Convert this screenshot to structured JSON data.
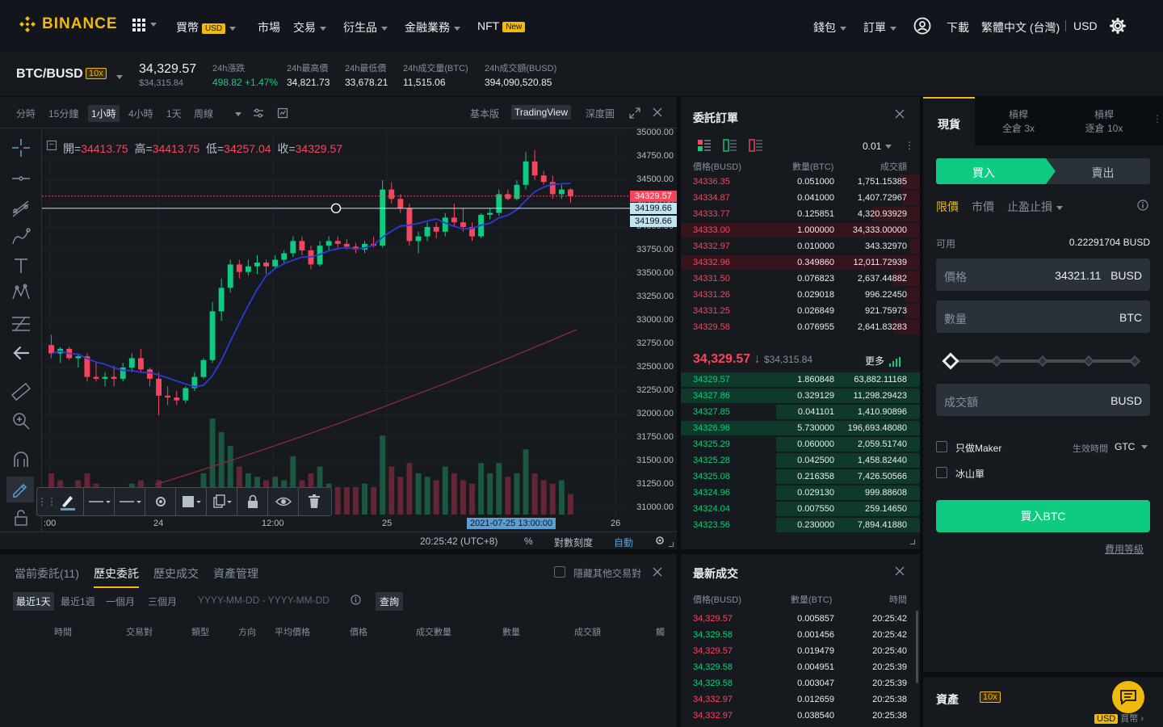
{
  "nav": {
    "logo_text": "BINANCE",
    "items": [
      {
        "label": "買幣",
        "badge": "USD",
        "caret": true
      },
      {
        "label": "市場",
        "caret": false
      },
      {
        "label": "交易",
        "caret": true
      },
      {
        "label": "衍生品",
        "caret": true
      },
      {
        "label": "金融業務",
        "caret": true
      },
      {
        "label": "NFT",
        "badge": "New",
        "caret": false
      }
    ],
    "right": {
      "wallet": "錢包",
      "orders": "訂單",
      "download": "下載",
      "language": "繁體中文 (台灣)",
      "currency": "USD"
    }
  },
  "ticker": {
    "symbol": "BTC/BUSD",
    "leverage": "10x",
    "last_price": "34,329.57",
    "last_price_usd": "$34,315.84",
    "change_label": "24h漲跌",
    "change_value": "498.82 +1.47%",
    "high_label": "24h最高價",
    "high_value": "34,821.73",
    "low_label": "24h最低價",
    "low_value": "33,678.21",
    "vol_btc_label": "24h成交量(BTC)",
    "vol_btc_value": "11,515.06",
    "vol_busd_label": "24h成交額(BUSD)",
    "vol_busd_value": "394,090,520.85"
  },
  "chart_toolbar": {
    "intervals": [
      "分時",
      "15分鐘",
      "1小時",
      "4小時",
      "1天",
      "周線"
    ],
    "active_interval": "1小時",
    "views": [
      "基本版",
      "TradingView",
      "深度圖"
    ],
    "active_view": "TradingView"
  },
  "ohlc": {
    "open_label": "開=",
    "open": "34413.75",
    "high_label": "高=",
    "high": "34413.75",
    "low_label": "低=",
    "low": "34257.04",
    "close_label": "收=",
    "close": "34329.57"
  },
  "chart_data": {
    "type": "candlestick",
    "y_ticks": [
      "35000.00",
      "34750.00",
      "34500.00",
      "34250.00",
      "34000.00",
      "33750.00",
      "33500.00",
      "33250.00",
      "33000.00",
      "32750.00",
      "32500.00",
      "32250.00",
      "32000.00",
      "31750.00",
      "31500.00",
      "31250.00",
      "31000.00"
    ],
    "ylim": [
      30900,
      35050
    ],
    "price_tags": [
      {
        "value": "34329.57",
        "price": 34329.57,
        "color": "#f6465d"
      },
      {
        "value": "34199.66",
        "price": 34199.66,
        "color": "#c0e4f0"
      },
      {
        "value": "34199.66",
        "price": 34199.66,
        "color": "#c0e4f0"
      }
    ],
    "x_ticks": [
      ":00",
      "24",
      "12:00",
      "25",
      "26"
    ],
    "crosshair_time": "2021-07-25 13:00:00",
    "candles": [
      {
        "o": 32740,
        "h": 32850,
        "l": 32600,
        "c": 32650
      },
      {
        "o": 32650,
        "h": 32720,
        "l": 32550,
        "c": 32700
      },
      {
        "o": 32700,
        "h": 32720,
        "l": 32580,
        "c": 32600
      },
      {
        "o": 32600,
        "h": 32650,
        "l": 32500,
        "c": 32620
      },
      {
        "o": 32620,
        "h": 32650,
        "l": 32350,
        "c": 32400
      },
      {
        "o": 32400,
        "h": 32550,
        "l": 32350,
        "c": 32380
      },
      {
        "o": 32380,
        "h": 32450,
        "l": 32300,
        "c": 32400
      },
      {
        "o": 32400,
        "h": 32520,
        "l": 32300,
        "c": 32380
      },
      {
        "o": 32380,
        "h": 32550,
        "l": 32350,
        "c": 32500
      },
      {
        "o": 32500,
        "h": 32650,
        "l": 32450,
        "c": 32600
      },
      {
        "o": 32600,
        "h": 32700,
        "l": 32450,
        "c": 32480
      },
      {
        "o": 32480,
        "h": 32500,
        "l": 32300,
        "c": 32380
      },
      {
        "o": 32380,
        "h": 32450,
        "l": 31990,
        "c": 32200
      },
      {
        "o": 32200,
        "h": 32300,
        "l": 32100,
        "c": 32180
      },
      {
        "o": 32180,
        "h": 32250,
        "l": 32100,
        "c": 32150
      },
      {
        "o": 32150,
        "h": 32300,
        "l": 32120,
        "c": 32280
      },
      {
        "o": 32280,
        "h": 32450,
        "l": 32250,
        "c": 32400
      },
      {
        "o": 32400,
        "h": 32600,
        "l": 32380,
        "c": 32580
      },
      {
        "o": 32580,
        "h": 33200,
        "l": 32550,
        "c": 33100
      },
      {
        "o": 33100,
        "h": 33450,
        "l": 33000,
        "c": 33350
      },
      {
        "o": 33350,
        "h": 33650,
        "l": 33300,
        "c": 33600
      },
      {
        "o": 33600,
        "h": 33650,
        "l": 33450,
        "c": 33520
      },
      {
        "o": 33520,
        "h": 33650,
        "l": 33480,
        "c": 33580
      },
      {
        "o": 33580,
        "h": 33700,
        "l": 33500,
        "c": 33620
      },
      {
        "o": 33620,
        "h": 33650,
        "l": 33500,
        "c": 33580
      },
      {
        "o": 33580,
        "h": 33700,
        "l": 33550,
        "c": 33650
      },
      {
        "o": 33650,
        "h": 33750,
        "l": 33600,
        "c": 33720
      },
      {
        "o": 33720,
        "h": 33900,
        "l": 33680,
        "c": 33850
      },
      {
        "o": 33850,
        "h": 33900,
        "l": 33700,
        "c": 33750
      },
      {
        "o": 33750,
        "h": 33800,
        "l": 33550,
        "c": 33600
      },
      {
        "o": 33600,
        "h": 33850,
        "l": 33580,
        "c": 33800
      },
      {
        "o": 33800,
        "h": 33900,
        "l": 33750,
        "c": 33850
      },
      {
        "o": 33850,
        "h": 33900,
        "l": 33780,
        "c": 33820
      },
      {
        "o": 33820,
        "h": 33870,
        "l": 33760,
        "c": 33790
      },
      {
        "o": 33790,
        "h": 33830,
        "l": 33720,
        "c": 33760
      },
      {
        "o": 33760,
        "h": 33850,
        "l": 33720,
        "c": 33820
      },
      {
        "o": 33820,
        "h": 33900,
        "l": 33780,
        "c": 33800
      },
      {
        "o": 33800,
        "h": 34500,
        "l": 33780,
        "c": 34400
      },
      {
        "o": 34400,
        "h": 34480,
        "l": 34250,
        "c": 34300
      },
      {
        "o": 34300,
        "h": 34350,
        "l": 34150,
        "c": 34200
      },
      {
        "o": 34200,
        "h": 34250,
        "l": 33800,
        "c": 33850
      },
      {
        "o": 33850,
        "h": 33950,
        "l": 33720,
        "c": 33900
      },
      {
        "o": 33900,
        "h": 34050,
        "l": 33850,
        "c": 34000
      },
      {
        "o": 34000,
        "h": 34050,
        "l": 33880,
        "c": 33950
      },
      {
        "o": 33950,
        "h": 34150,
        "l": 33900,
        "c": 34100
      },
      {
        "o": 34100,
        "h": 34250,
        "l": 34000,
        "c": 34050
      },
      {
        "o": 34050,
        "h": 34200,
        "l": 33950,
        "c": 34000
      },
      {
        "o": 34000,
        "h": 34050,
        "l": 33850,
        "c": 33900
      },
      {
        "o": 33900,
        "h": 34150,
        "l": 33880,
        "c": 34130
      },
      {
        "o": 34130,
        "h": 34200,
        "l": 34080,
        "c": 34150
      },
      {
        "o": 34150,
        "h": 34400,
        "l": 34120,
        "c": 34350
      },
      {
        "o": 34350,
        "h": 34400,
        "l": 34280,
        "c": 34300
      },
      {
        "o": 34300,
        "h": 34500,
        "l": 34280,
        "c": 34450
      },
      {
        "o": 34450,
        "h": 34800,
        "l": 34400,
        "c": 34700
      },
      {
        "o": 34700,
        "h": 34820,
        "l": 34500,
        "c": 34550
      },
      {
        "o": 34550,
        "h": 34600,
        "l": 34450,
        "c": 34480
      },
      {
        "o": 34480,
        "h": 34550,
        "l": 34300,
        "c": 34350
      },
      {
        "o": 34350,
        "h": 34450,
        "l": 34300,
        "c": 34400
      },
      {
        "o": 34400,
        "h": 34413,
        "l": 34257,
        "c": 34329
      }
    ],
    "volumes": [
      {
        "v": 0.6,
        "up": false
      },
      {
        "v": 0.5,
        "up": false
      },
      {
        "v": 0.4,
        "up": true
      },
      {
        "v": 0.5,
        "up": false
      },
      {
        "v": 0.6,
        "up": false
      },
      {
        "v": 0.45,
        "up": false
      },
      {
        "v": 0.3,
        "up": true
      },
      {
        "v": 0.35,
        "up": false
      },
      {
        "v": 0.4,
        "up": true
      },
      {
        "v": 0.45,
        "up": true
      },
      {
        "v": 0.5,
        "up": false
      },
      {
        "v": 0.35,
        "up": false
      },
      {
        "v": 0.5,
        "up": false
      },
      {
        "v": 0.3,
        "up": false
      },
      {
        "v": 0.25,
        "up": false
      },
      {
        "v": 0.3,
        "up": true
      },
      {
        "v": 0.35,
        "up": true
      },
      {
        "v": 0.6,
        "up": true
      },
      {
        "v": 1.4,
        "up": true
      },
      {
        "v": 1.2,
        "up": true
      },
      {
        "v": 1.0,
        "up": true
      },
      {
        "v": 0.7,
        "up": false
      },
      {
        "v": 0.6,
        "up": true
      },
      {
        "v": 0.55,
        "up": true
      },
      {
        "v": 0.5,
        "up": false
      },
      {
        "v": 0.55,
        "up": true
      },
      {
        "v": 0.5,
        "up": true
      },
      {
        "v": 0.85,
        "up": true
      },
      {
        "v": 0.5,
        "up": false
      },
      {
        "v": 0.6,
        "up": false
      },
      {
        "v": 0.7,
        "up": true
      },
      {
        "v": 0.45,
        "up": true
      },
      {
        "v": 0.4,
        "up": false
      },
      {
        "v": 0.4,
        "up": false
      },
      {
        "v": 0.4,
        "up": false
      },
      {
        "v": 0.45,
        "up": true
      },
      {
        "v": 0.4,
        "up": false
      },
      {
        "v": 1.15,
        "up": true
      },
      {
        "v": 0.7,
        "up": false
      },
      {
        "v": 0.55,
        "up": false
      },
      {
        "v": 0.75,
        "up": false
      },
      {
        "v": 0.6,
        "up": true
      },
      {
        "v": 0.55,
        "up": true
      },
      {
        "v": 0.5,
        "up": false
      },
      {
        "v": 0.7,
        "up": true
      },
      {
        "v": 0.6,
        "up": false
      },
      {
        "v": 0.5,
        "up": false
      },
      {
        "v": 0.45,
        "up": false
      },
      {
        "v": 0.75,
        "up": true
      },
      {
        "v": 0.6,
        "up": true
      },
      {
        "v": 0.75,
        "up": true
      },
      {
        "v": 0.55,
        "up": false
      },
      {
        "v": 0.6,
        "up": true
      },
      {
        "v": 0.95,
        "up": true
      },
      {
        "v": 0.6,
        "up": false
      },
      {
        "v": 0.5,
        "up": false
      },
      {
        "v": 0.45,
        "up": false
      },
      {
        "v": 0.5,
        "up": true
      },
      {
        "v": 0.3,
        "up": false
      }
    ]
  },
  "chart_bottom": {
    "clock": "20:25:42 (UTC+8)",
    "percent": "%",
    "log": "對數刻度",
    "auto": "自動"
  },
  "orderbook": {
    "title": "委託訂單",
    "precision": "0.01",
    "col_price": "價格(BUSD)",
    "col_qty": "數量(BTC)",
    "col_total": "成交額",
    "asks": [
      {
        "price": "34336.35",
        "qty": "0.051000",
        "total": "1,751.15385",
        "depth": 0.08
      },
      {
        "price": "34334.87",
        "qty": "0.041000",
        "total": "1,407.72967",
        "depth": 0.07
      },
      {
        "price": "34333.77",
        "qty": "0.125851",
        "total": "4,320.93929",
        "depth": 0.2
      },
      {
        "price": "34333.00",
        "qty": "1.000000",
        "total": "34,333.00000",
        "depth": 1.0
      },
      {
        "price": "34332.97",
        "qty": "0.010000",
        "total": "343.32970",
        "depth": 0.04
      },
      {
        "price": "34332.96",
        "qty": "0.349860",
        "total": "12,011.72939",
        "depth": 1.0
      },
      {
        "price": "34331.50",
        "qty": "0.076823",
        "total": "2,637.44882",
        "depth": 0.11
      },
      {
        "price": "34331.26",
        "qty": "0.029018",
        "total": "996.22450",
        "depth": 0.06
      },
      {
        "price": "34331.25",
        "qty": "0.026849",
        "total": "921.75973",
        "depth": 0.06
      },
      {
        "price": "34329.58",
        "qty": "0.076955",
        "total": "2,641.83283",
        "depth": 0.11
      }
    ],
    "mid_price": "34,329.57",
    "mid_usd": "$34,315.84",
    "more": "更多",
    "bids": [
      {
        "price": "34329.57",
        "qty": "1.860848",
        "total": "63,882.11168",
        "depth": 1.0
      },
      {
        "price": "34327.86",
        "qty": "0.329129",
        "total": "11,298.29423",
        "depth": 1.0
      },
      {
        "price": "34327.85",
        "qty": "0.041101",
        "total": "1,410.90896",
        "depth": 0.6
      },
      {
        "price": "34326.96",
        "qty": "5.730000",
        "total": "196,693.48080",
        "depth": 1.0
      },
      {
        "price": "34325.29",
        "qty": "0.060000",
        "total": "2,059.51740",
        "depth": 0.6
      },
      {
        "price": "34325.28",
        "qty": "0.042500",
        "total": "1,458.82440",
        "depth": 0.6
      },
      {
        "price": "34325.08",
        "qty": "0.216358",
        "total": "7,426.50566",
        "depth": 0.6
      },
      {
        "price": "34324.96",
        "qty": "0.029130",
        "total": "999.88608",
        "depth": 0.6
      },
      {
        "price": "34324.04",
        "qty": "0.007550",
        "total": "259.14650",
        "depth": 0.6
      },
      {
        "price": "34323.56",
        "qty": "0.230000",
        "total": "7,894.41880",
        "depth": 0.6
      }
    ]
  },
  "trades": {
    "title": "最新成交",
    "col_price": "價格(BUSD)",
    "col_qty": "數量(BTC)",
    "col_time": "時間",
    "rows": [
      {
        "price": "34,329.57",
        "qty": "0.005857",
        "time": "20:25:42",
        "side": "sell"
      },
      {
        "price": "34,329.58",
        "qty": "0.001456",
        "time": "20:25:42",
        "side": "buy"
      },
      {
        "price": "34,329.57",
        "qty": "0.019479",
        "time": "20:25:40",
        "side": "sell"
      },
      {
        "price": "34,329.58",
        "qty": "0.004951",
        "time": "20:25:39",
        "side": "buy"
      },
      {
        "price": "34,329.58",
        "qty": "0.003047",
        "time": "20:25:39",
        "side": "buy"
      },
      {
        "price": "34,332.97",
        "qty": "0.012659",
        "time": "20:25:38",
        "side": "sell"
      },
      {
        "price": "34,332.97",
        "qty": "0.038540",
        "time": "20:25:38",
        "side": "sell"
      }
    ]
  },
  "history": {
    "tabs": [
      "當前委託(11)",
      "歷史委託",
      "歷史成交",
      "資產管理"
    ],
    "active_tab": "歷史委託",
    "hide_pairs": "隱藏其他交易對",
    "ranges": [
      "最近1天",
      "最近1週",
      "一個月",
      "三個月"
    ],
    "date_placeholder": "YYYY-MM-DD - YYYY-MM-DD",
    "query": "查詢",
    "columns": [
      "時間",
      "交易對",
      "類型",
      "方向",
      "平均價格",
      "價格",
      "成交數量",
      "數量",
      "成交額",
      "觸"
    ]
  },
  "trade": {
    "tabs": [
      {
        "line1": "現貨",
        "line2": ""
      },
      {
        "line1": "槓桿",
        "line2": "全倉 3x"
      },
      {
        "line1": "槓桿",
        "line2": "逐倉 10x"
      }
    ],
    "buy": "買入",
    "sell": "賣出",
    "order_types": [
      "限價",
      "市價",
      "止盈止損"
    ],
    "available_label": "可用",
    "available_value": "0.22291704 BUSD",
    "price_label": "價格",
    "price_value": "34321.11",
    "price_unit": "BUSD",
    "qty_label": "數量",
    "qty_unit": "BTC",
    "total_label": "成交額",
    "total_unit": "BUSD",
    "slider_percent": 0,
    "maker_only": "只做Maker",
    "iceberg": "冰山單",
    "tif_label": "生效時間",
    "tif_value": "GTC",
    "submit": "買入BTC",
    "fee_link": "費用等級",
    "assets": "資產",
    "assets_lev": "10x",
    "buy_crypto_currency": "USD",
    "buy_crypto_label": "買幣"
  },
  "colors": {
    "up": "#0ecb81",
    "down": "#f6465d",
    "accent": "#f0b90b",
    "bg": "#161a1e"
  }
}
